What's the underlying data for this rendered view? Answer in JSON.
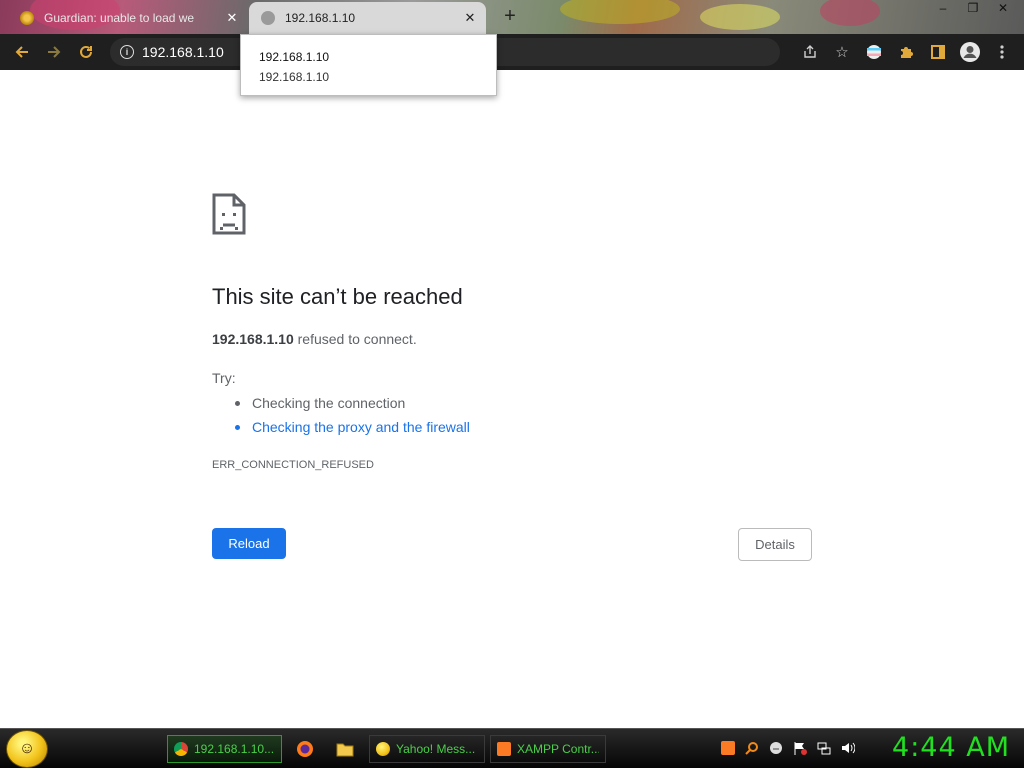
{
  "browser": {
    "tabs": [
      {
        "title": "Guardian: unable to load we",
        "active": false
      },
      {
        "title": "192.168.1.10",
        "active": true
      }
    ],
    "new_tab_icon": "plus-icon",
    "window_controls": [
      "minimize-icon",
      "restore-icon",
      "close-icon"
    ],
    "window_control_glyphs": [
      "‒",
      "❐",
      "✕"
    ],
    "address": "192.168.1.10",
    "toolbar_right_icons": [
      "share-icon",
      "star-icon",
      "flag-extension-icon",
      "puzzle-extension-icon",
      "sidepanel-icon",
      "profile-icon",
      "menu-icon"
    ]
  },
  "tab_tooltip": {
    "title": "192.168.1.10",
    "url": "192.168.1.10"
  },
  "error_page": {
    "title": "This site can’t be reached",
    "host": "192.168.1.10",
    "description_suffix": " refused to connect.",
    "try_label": "Try:",
    "suggestions": [
      {
        "text": "Checking the connection",
        "link": false
      },
      {
        "text": "Checking the proxy and the firewall",
        "link": true
      }
    ],
    "error_code": "ERR_CONNECTION_REFUSED",
    "reload_label": "Reload",
    "details_label": "Details",
    "colors": {
      "primary": "#1a73e8",
      "text": "#5f6368",
      "title": "#202124"
    }
  },
  "taskbar": {
    "tasks": [
      {
        "label": "192.168.1.10...",
        "icon": "chrome-icon",
        "active": true
      },
      {
        "label": "Yahoo! Mess...",
        "icon": "yahoo-messenger-icon",
        "active": false
      },
      {
        "label": "XAMPP Contr...",
        "icon": "xampp-icon",
        "active": false
      }
    ],
    "quick_launch": [
      "firefox-icon",
      "folder-icon"
    ],
    "tray_icons": [
      "xampp-tray-icon",
      "search-tray-icon",
      "messenger-tray-icon",
      "action-center-icon",
      "network-icon",
      "volume-icon"
    ],
    "clock": "4:44 AM",
    "clock_color": "#20e020"
  }
}
